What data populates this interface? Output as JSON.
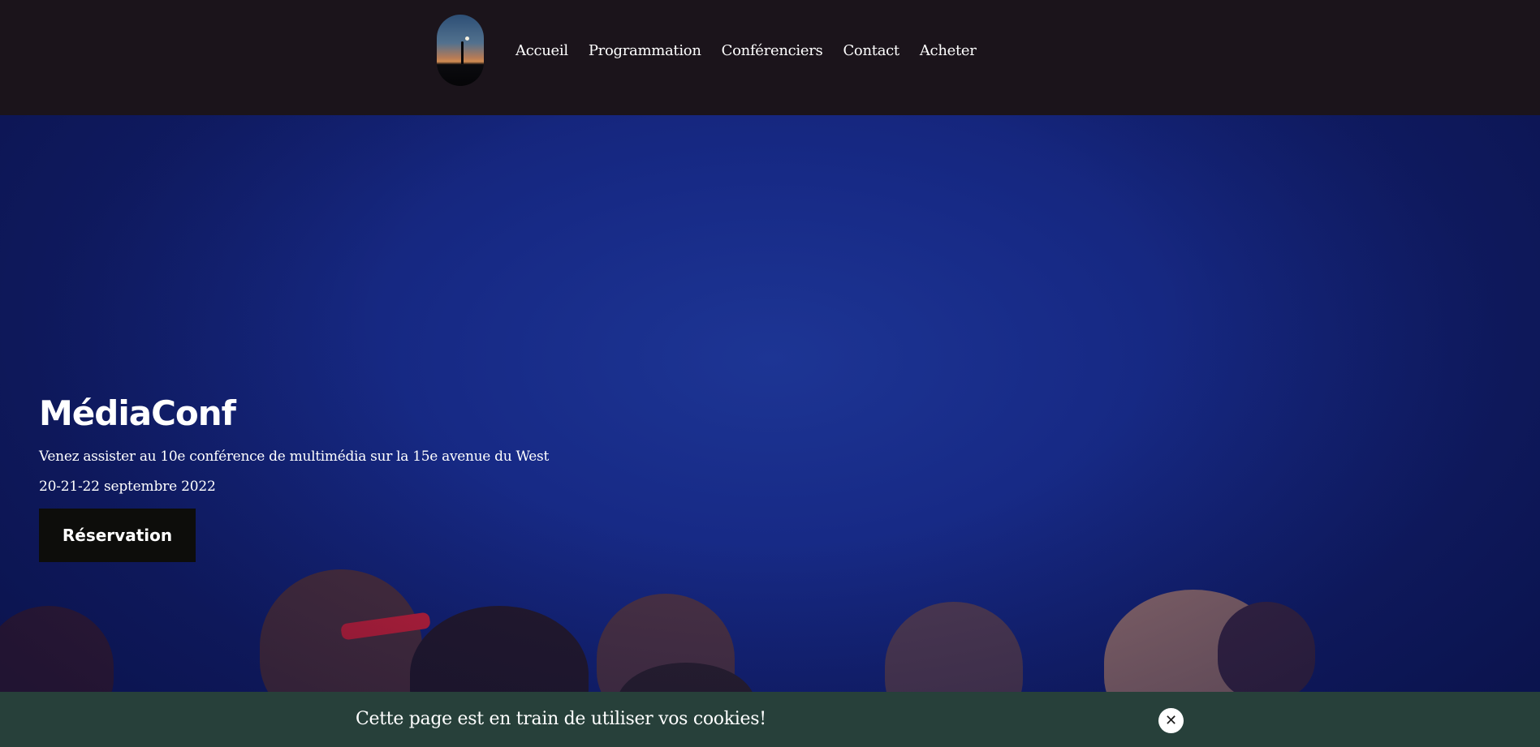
{
  "header": {
    "logo_icon": "night-sky-figure-logo",
    "nav": [
      {
        "label": "Accueil"
      },
      {
        "label": "Programmation"
      },
      {
        "label": "Conférenciers"
      },
      {
        "label": "Contact"
      },
      {
        "label": "Acheter"
      }
    ]
  },
  "hero": {
    "title": "MédiaConf",
    "subtitle": "Venez assister au 10e conférence de multimédia sur la 15e avenue du West",
    "dates": "20-21-22 septembre 2022",
    "cta_label": "Réservation",
    "background_color": "#1a2f8c"
  },
  "cookie_banner": {
    "message": "Cette page est en train de utiliser vos cookies!",
    "close_glyph": "✕",
    "close_icon": "close-icon",
    "background_color": "#27403a"
  }
}
